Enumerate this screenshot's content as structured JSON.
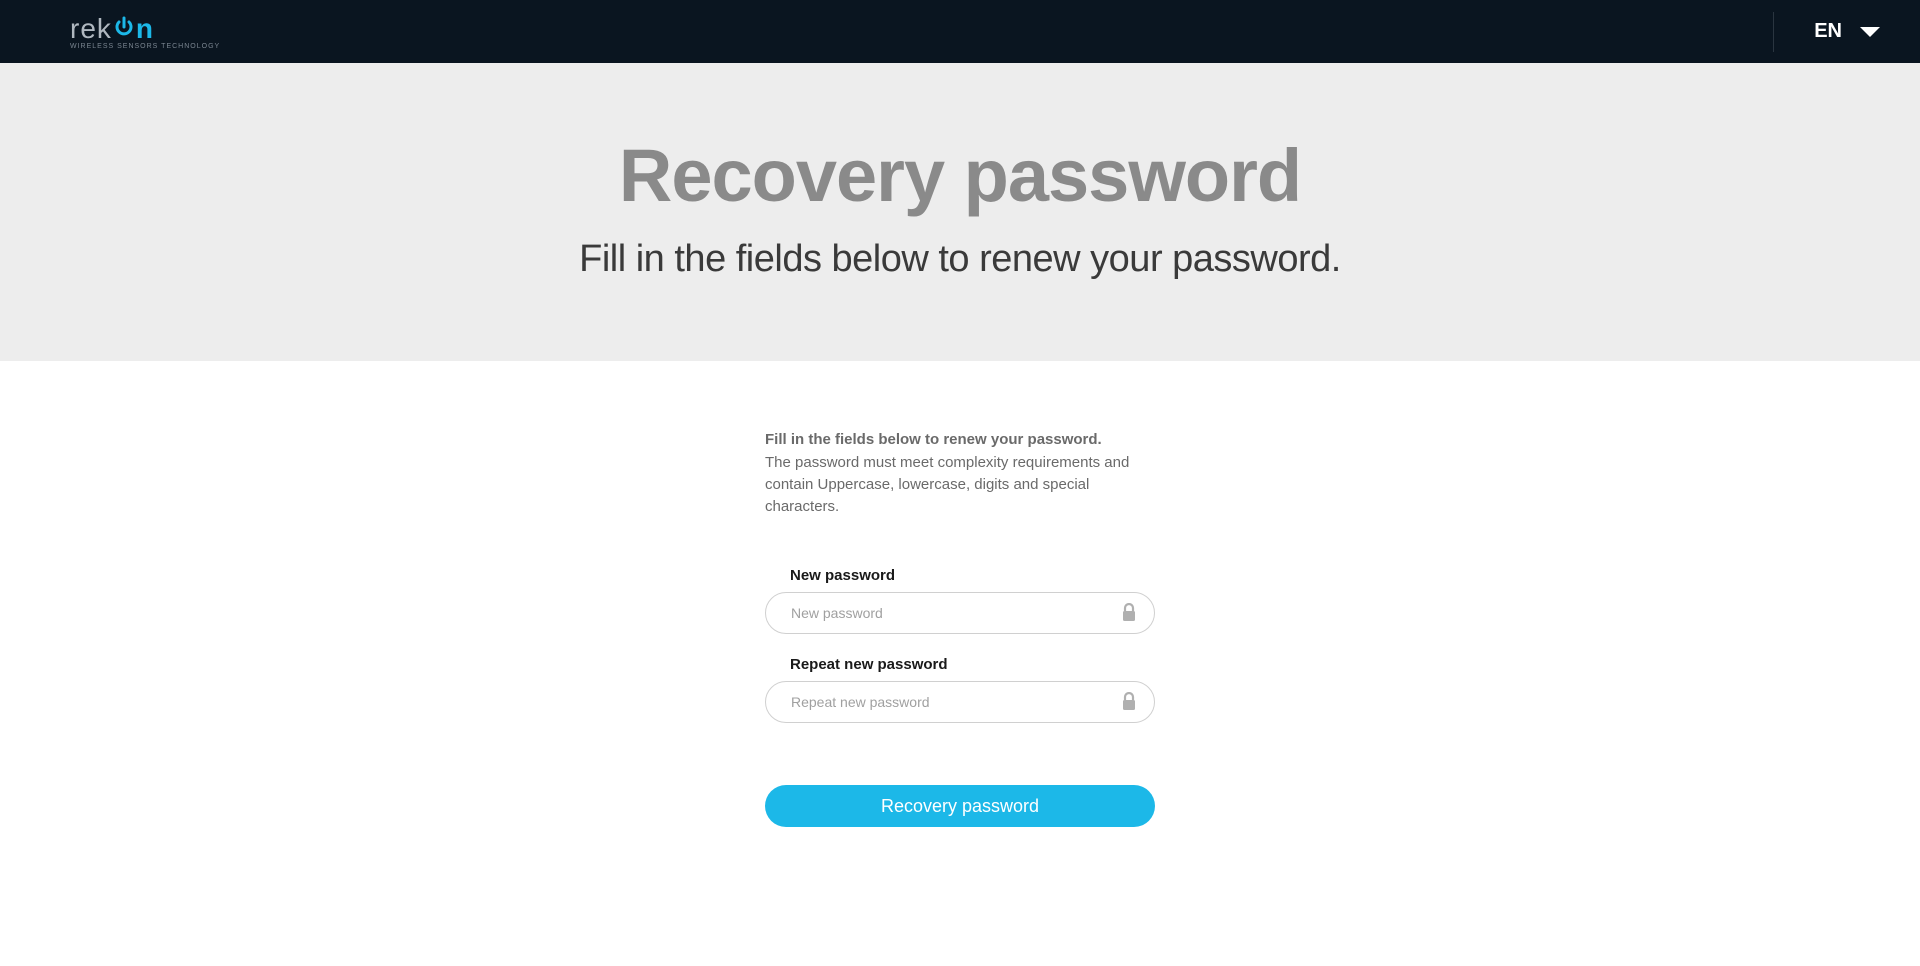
{
  "header": {
    "logo_text_left": "rek",
    "logo_text_right": "n",
    "logo_tagline": "WIRELESS SENSORS TECHNOLOGY",
    "language": "EN"
  },
  "hero": {
    "title": "Recovery password",
    "subtitle": "Fill in the fields below to renew your password."
  },
  "form": {
    "instr_title": "Fill in the fields below to renew your password.",
    "instr_desc": "The password must meet complexity requirements and contain Uppercase, lowercase, digits and special characters.",
    "new_password_label": "New password",
    "new_password_placeholder": "New password",
    "repeat_password_label": "Repeat new password",
    "repeat_password_placeholder": "Repeat new password",
    "submit_label": "Recovery password"
  }
}
